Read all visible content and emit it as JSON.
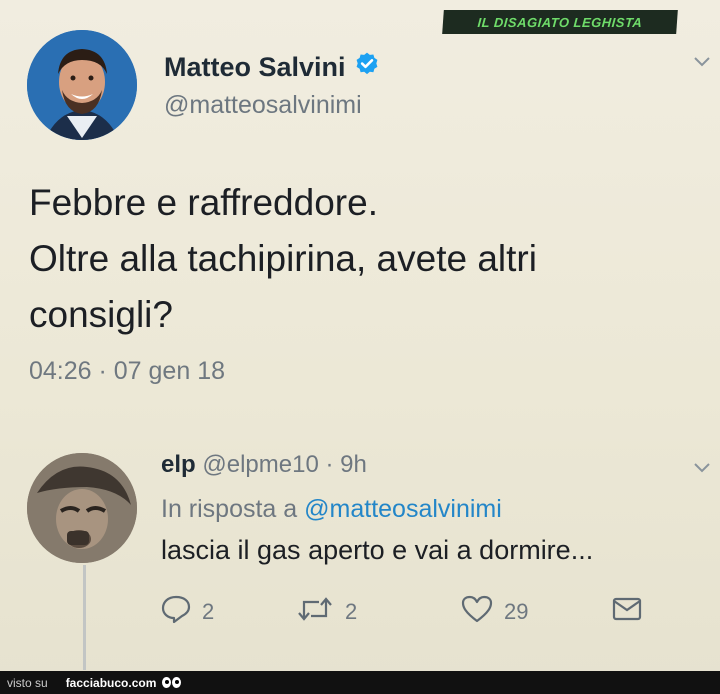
{
  "watermark": "IL DISAGIATO LEGHISTA",
  "tweet": {
    "author_name": "Matteo Salvini",
    "handle": "@matteosalvinimi",
    "verified_icon": "verified-badge-icon",
    "text_lines": [
      "Febbre e raffreddore.",
      "Oltre alla tachipirina, avete altri",
      "consigli?"
    ],
    "timestamp": "04:26 · 07 gen 18"
  },
  "reply": {
    "author_name": "elp",
    "handle": "@elpme10",
    "separator": " · ",
    "time": "9h",
    "in_reply_prefix": "In risposta a ",
    "in_reply_mention": "@matteosalvinimi",
    "text": "lascia il gas aperto e vai a dormire...",
    "actions": {
      "reply_count": "2",
      "retweet_count": "2",
      "like_count": "29"
    }
  },
  "footer": {
    "visto_su": "visto su",
    "site": "facciabuco.com"
  },
  "colors": {
    "background": "#ede9d9",
    "verified": "#1da1f2",
    "mention": "#2386c8",
    "watermark_bg": "#1d2b20",
    "watermark_text": "#6fdc6a"
  }
}
